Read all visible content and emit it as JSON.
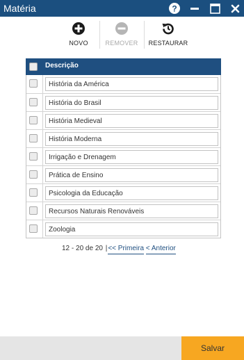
{
  "window": {
    "title": "Matéria",
    "controls": [
      "help-icon",
      "minimize-icon",
      "maximize-icon",
      "close-icon"
    ],
    "title_bar_color": "#1b4f7f"
  },
  "toolbar": {
    "new_label": "NOVO",
    "remove_label": "REMOVER",
    "restore_label": "RESTAURAR"
  },
  "grid": {
    "header_label": "Descrição",
    "header_color": "#1f4f80",
    "rows": [
      {
        "description": "História da América",
        "checked": false
      },
      {
        "description": "História do Brasil",
        "checked": false
      },
      {
        "description": "História Medieval",
        "checked": false
      },
      {
        "description": "História Moderna",
        "checked": false
      },
      {
        "description": "Irrigação e Drenagem",
        "checked": false
      },
      {
        "description": "Prática de Ensino",
        "checked": false
      },
      {
        "description": "Psicologia da Educação",
        "checked": false
      },
      {
        "description": "Recursos Naturais Renováveis",
        "checked": false
      },
      {
        "description": "Zoologia",
        "checked": false
      }
    ]
  },
  "pager": {
    "range": "12 - 20 de 20",
    "separator": "|",
    "first_label": "<< Primeira",
    "previous_label": "< Anterior"
  },
  "footer": {
    "save_label": "Salvar",
    "save_color": "#f7a721"
  }
}
